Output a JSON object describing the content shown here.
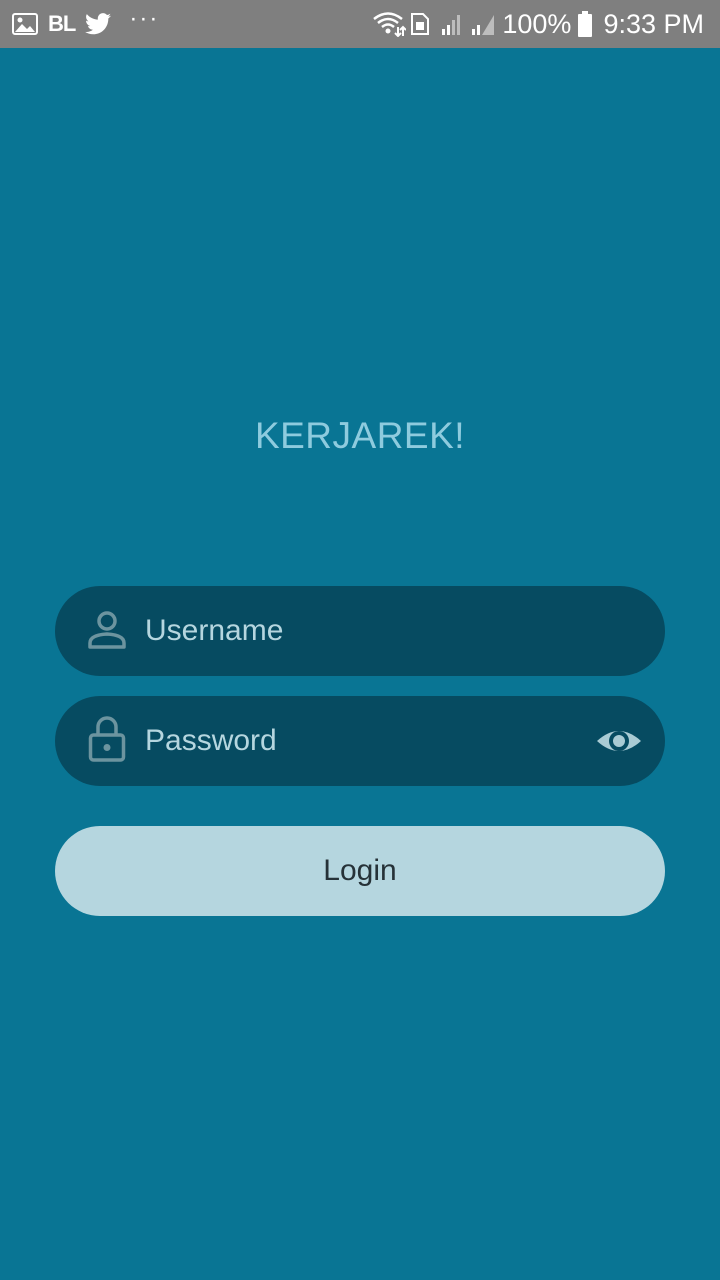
{
  "status_bar": {
    "left_icons": [
      "gallery-icon",
      "bl-app-icon",
      "twitter-icon",
      "more-notifications-icon"
    ],
    "bl_label": "BL",
    "more_label": "···",
    "right_icons": [
      "wifi-icon",
      "sim-icon",
      "signal-icon",
      "signal-icon",
      "battery-icon"
    ],
    "battery_percent": "100%",
    "time": "9:33 PM"
  },
  "app": {
    "title": "KERJAREK!"
  },
  "login_form": {
    "username_placeholder": "Username",
    "password_placeholder": "Password",
    "login_label": "Login",
    "icons": {
      "username": "person-icon",
      "password": "lock-icon",
      "visibility": "eye-icon"
    }
  },
  "colors": {
    "background": "#097594",
    "status_bar": "#7f7f7f",
    "field_background": "#064b61",
    "button_background": "#b5d6df",
    "title_text": "#8ecbde"
  }
}
